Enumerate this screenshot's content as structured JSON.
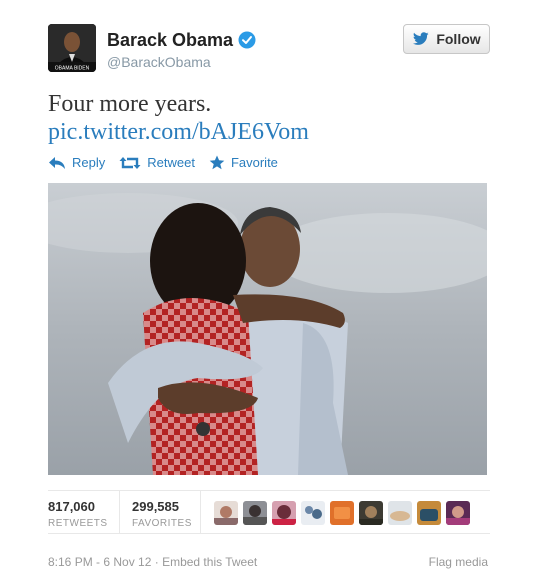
{
  "user": {
    "name": "Barack Obama",
    "handle": "@BarackObama",
    "avatar_caption": "OBAMA BIDEN",
    "verified": true,
    "follow_label": "Follow"
  },
  "tweet": {
    "text": "Four more years.",
    "link": "pic.twitter.com/bAJE6Vom"
  },
  "actions": {
    "reply": "Reply",
    "retweet": "Retweet",
    "favorite": "Favorite"
  },
  "stats": {
    "retweets_count": "817,060",
    "retweets_label": "RETWEETS",
    "favorites_count": "299,585",
    "favorites_label": "FAVORITES"
  },
  "favoriter_avatars": [
    "avatar-1",
    "avatar-2",
    "avatar-3",
    "avatar-4",
    "avatar-5",
    "avatar-6",
    "avatar-7",
    "avatar-8",
    "avatar-9"
  ],
  "footer": {
    "timestamp": "8:16 PM - 6 Nov 12",
    "separator": "·",
    "embed": "Embed this Tweet",
    "flag": "Flag media"
  },
  "colors": {
    "link_blue": "#2a7dbd",
    "verified_blue": "#2b9be6",
    "muted": "#999999"
  }
}
